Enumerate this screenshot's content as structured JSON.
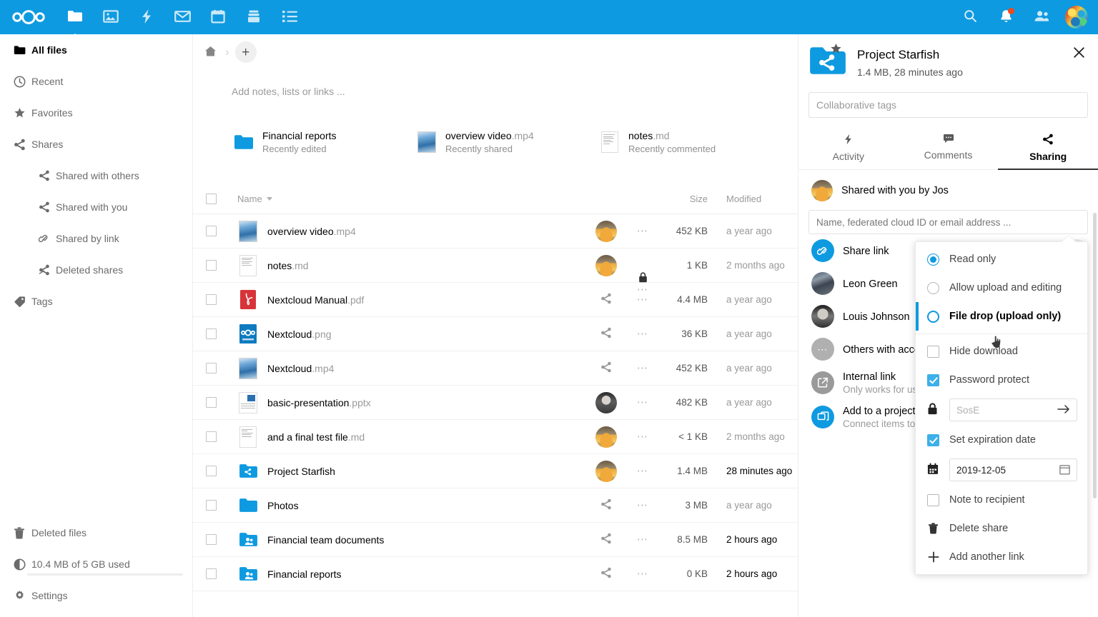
{
  "header": {
    "logo": "nextcloud-logo",
    "apps": [
      {
        "name": "files",
        "icon": "folder-icon",
        "active": true
      },
      {
        "name": "photos",
        "icon": "image-icon",
        "active": false
      },
      {
        "name": "activity",
        "icon": "lightning-icon",
        "active": false
      },
      {
        "name": "mail",
        "icon": "envelope-icon",
        "active": false
      },
      {
        "name": "calendar",
        "icon": "calendar-icon",
        "active": false
      },
      {
        "name": "deck",
        "icon": "deck-icon",
        "active": false
      },
      {
        "name": "tasks",
        "icon": "list-icon",
        "active": false
      }
    ],
    "right": [
      {
        "name": "search",
        "icon": "search-icon"
      },
      {
        "name": "notifications",
        "icon": "bell-icon",
        "badge": true
      },
      {
        "name": "contacts",
        "icon": "contacts-icon"
      },
      {
        "name": "user-menu",
        "icon": "avatar"
      }
    ]
  },
  "sidebar": {
    "items": [
      {
        "label": "All files",
        "icon": "folder-icon",
        "active": true,
        "sub": false
      },
      {
        "label": "Recent",
        "icon": "clock-icon",
        "active": false,
        "sub": false
      },
      {
        "label": "Favorites",
        "icon": "star-icon",
        "active": false,
        "sub": false
      },
      {
        "label": "Shares",
        "icon": "share-icon",
        "active": false,
        "sub": false
      },
      {
        "label": "Shared with others",
        "icon": "share-icon",
        "active": false,
        "sub": true
      },
      {
        "label": "Shared with you",
        "icon": "share-icon",
        "active": false,
        "sub": true
      },
      {
        "label": "Shared by link",
        "icon": "link-icon",
        "active": false,
        "sub": true
      },
      {
        "label": "Deleted shares",
        "icon": "share-off-icon",
        "active": false,
        "sub": true
      },
      {
        "label": "Tags",
        "icon": "tag-icon",
        "active": false,
        "sub": false
      }
    ],
    "bottom": {
      "deleted_files": "Deleted files",
      "quota": "10.4 MB of 5 GB used",
      "quota_percent": 0.2,
      "settings": "Settings"
    }
  },
  "main": {
    "breadcrumb": {
      "home": "home-icon",
      "add": "+"
    },
    "notes_placeholder": "Add notes, lists or links ...",
    "recent": [
      {
        "name": "Financial reports",
        "ext": "",
        "sub": "Recently edited",
        "icon": "folder-icon"
      },
      {
        "name": "overview video",
        "ext": ".mp4",
        "sub": "Recently shared",
        "icon": "video-thumb"
      },
      {
        "name": "notes",
        "ext": ".md",
        "sub": "Recently commented",
        "icon": "doc-thumb"
      }
    ],
    "table": {
      "columns": {
        "name": "Name",
        "size": "Size",
        "modified": "Modified"
      },
      "rows": [
        {
          "name": "overview video",
          "ext": ".mp4",
          "icon": "video-thumb",
          "share": "avatar-bus",
          "size": "452 KB",
          "modified": "a year ago",
          "recent": false
        },
        {
          "name": "notes",
          "ext": ".md",
          "icon": "doc-thumb",
          "share": "avatar-bus",
          "lock": true,
          "size": "1 KB",
          "modified": "2 months ago",
          "recent": false
        },
        {
          "name": "Nextcloud Manual",
          "ext": ".pdf",
          "icon": "pdf-icon",
          "share": "share-icon",
          "size": "4.4 MB",
          "modified": "a year ago",
          "recent": false
        },
        {
          "name": "Nextcloud",
          "ext": ".png",
          "icon": "png-icon",
          "share": "share-icon",
          "size": "36 KB",
          "modified": "a year ago",
          "recent": false
        },
        {
          "name": "Nextcloud",
          "ext": ".mp4",
          "icon": "video-thumb",
          "share": "share-icon",
          "size": "452 KB",
          "modified": "a year ago",
          "recent": false
        },
        {
          "name": "basic-presentation",
          "ext": ".pptx",
          "icon": "pptx-thumb",
          "share": "avatar-man",
          "size": "482 KB",
          "modified": "a year ago",
          "recent": false
        },
        {
          "name": "and a final test file",
          "ext": ".md",
          "icon": "doc-thumb",
          "share": "avatar-bus",
          "size": "< 1 KB",
          "modified": "2 months ago",
          "recent": false
        },
        {
          "name": "Project Starfish",
          "ext": "",
          "icon": "folder-share-icon",
          "share": "avatar-bus",
          "size": "1.4 MB",
          "modified": "28 minutes ago",
          "recent": true
        },
        {
          "name": "Photos",
          "ext": "",
          "icon": "folder-icon",
          "share": "share-icon",
          "size": "3 MB",
          "modified": "a year ago",
          "recent": false
        },
        {
          "name": "Financial team documents",
          "ext": "",
          "icon": "folder-group-icon",
          "share": "share-icon",
          "size": "8.5 MB",
          "modified": "2 hours ago",
          "recent": true
        },
        {
          "name": "Financial reports",
          "ext": "",
          "icon": "folder-group-icon",
          "share": "share-icon",
          "size": "0 KB",
          "modified": "2 hours ago",
          "recent": true
        }
      ]
    }
  },
  "details": {
    "file_name": "Project Starfish",
    "file_meta": "1.4 MB, 28 minutes ago",
    "favorited": true,
    "tags_placeholder": "Collaborative tags",
    "tabs": [
      {
        "label": "Activity",
        "icon": "lightning-icon",
        "active": false
      },
      {
        "label": "Comments",
        "icon": "comment-icon",
        "active": false
      },
      {
        "label": "Sharing",
        "icon": "share-icon",
        "active": true
      }
    ],
    "shared_with_you": "Shared with you by Jos",
    "share_search_placeholder": "Name, federated cloud ID or email address ...",
    "shares": [
      {
        "title": "Share link",
        "sub": "",
        "avatar": "link-avatar",
        "actions": [
          "copy-link-icon",
          "more-icon"
        ]
      },
      {
        "title": "Leon Green",
        "sub": "",
        "avatar": "leon-avatar",
        "actions": []
      },
      {
        "title": "Louis Johnson",
        "sub": "",
        "avatar": "louis-avatar",
        "actions": []
      },
      {
        "title": "Others with access",
        "sub": "",
        "avatar": "dots-avatar",
        "actions": []
      },
      {
        "title": "Internal link",
        "sub": "Only works for users with access to this folder",
        "avatar": "internal-link-avatar",
        "actions": []
      },
      {
        "title": "Add to a project",
        "sub": "Connect items to a project to make them easier to find",
        "avatar": "project-avatar",
        "actions": []
      }
    ]
  },
  "popup": {
    "permissions": [
      {
        "label": "Read only",
        "state": "selected",
        "hovered": false
      },
      {
        "label": "Allow upload and editing",
        "state": "unselected",
        "hovered": false
      },
      {
        "label": "File drop (upload only)",
        "state": "ring",
        "hovered": true
      }
    ],
    "options": [
      {
        "label": "Hide download",
        "checked": false
      },
      {
        "label": "Password protect",
        "checked": true
      }
    ],
    "password": {
      "icon": "lock-icon",
      "placeholder": "SosE",
      "value": "",
      "submit": "arrow-right-icon"
    },
    "expiration": {
      "label": "Set expiration date",
      "checked": true,
      "icon": "calendar-icon",
      "value": "2019-12-05",
      "picker": "calendar-picker-icon"
    },
    "note": {
      "label": "Note to recipient",
      "checked": false
    },
    "actions": [
      {
        "label": "Delete share",
        "icon": "trash-icon"
      },
      {
        "label": "Add another link",
        "icon": "plus-icon"
      }
    ]
  },
  "colors": {
    "brand": "#0e9ae0",
    "accent": "#3cb0ea",
    "notification": "#ec4b20",
    "pdf": "#d7343a"
  }
}
